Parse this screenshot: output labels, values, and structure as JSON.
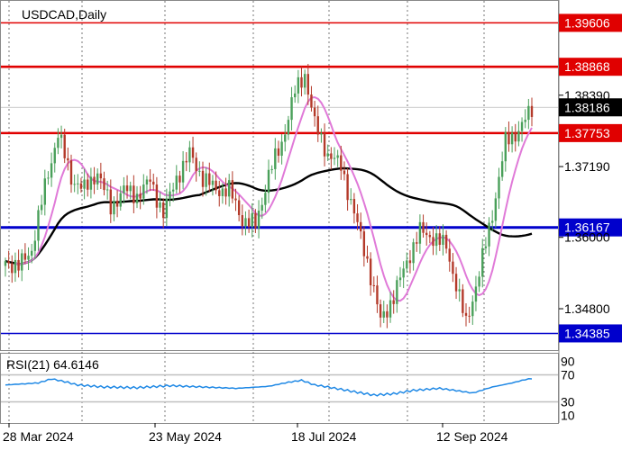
{
  "chart_data": [
    {
      "type": "candlestick",
      "title": "USDCAD,Daily",
      "x_tick_labels": [
        "28 Mar 2024",
        "23 May 2024",
        "18 Jul 2024",
        "12 Sep 2024"
      ],
      "y_tick_labels": [
        "1.38390",
        "1.37190",
        "1.36000",
        "1.34800"
      ],
      "ylim": [
        1.3418,
        1.399
      ],
      "current_price": "1.38186",
      "grid": "vertical dashed",
      "colors": {
        "bull": "#4aa05a",
        "bear": "#b43a2a",
        "ma_fast": "#e07ad8",
        "ma_slow": "#000000",
        "resistance": "#e00000",
        "support": "#0000cc"
      },
      "levels": [
        {
          "label": "1.39606",
          "value": 1.39606,
          "kind": "resistance"
        },
        {
          "label": "1.38868",
          "value": 1.38868,
          "kind": "resistance"
        },
        {
          "label": "1.37753",
          "value": 1.37753,
          "kind": "resistance"
        },
        {
          "label": "1.36167",
          "value": 1.36167,
          "kind": "support"
        },
        {
          "label": "1.34385",
          "value": 1.34385,
          "kind": "support"
        }
      ],
      "close_anchors": [
        [
          0,
          1.356
        ],
        [
          4,
          1.355
        ],
        [
          8,
          1.358
        ],
        [
          12,
          1.3685
        ],
        [
          16,
          1.3775
        ],
        [
          20,
          1.37
        ],
        [
          24,
          1.368
        ],
        [
          28,
          1.371
        ],
        [
          32,
          1.365
        ],
        [
          36,
          1.368
        ],
        [
          40,
          1.367
        ],
        [
          44,
          1.3695
        ],
        [
          48,
          1.364
        ],
        [
          52,
          1.37
        ],
        [
          56,
          1.374
        ],
        [
          60,
          1.37
        ],
        [
          64,
          1.368
        ],
        [
          68,
          1.368
        ],
        [
          72,
          1.363
        ],
        [
          76,
          1.362
        ],
        [
          80,
          1.3705
        ],
        [
          84,
          1.376
        ],
        [
          88,
          1.3845
        ],
        [
          91,
          1.3875
        ],
        [
          94,
          1.379
        ],
        [
          98,
          1.374
        ],
        [
          102,
          1.372
        ],
        [
          106,
          1.364
        ],
        [
          110,
          1.356
        ],
        [
          114,
          1.346
        ],
        [
          118,
          1.35
        ],
        [
          122,
          1.356
        ],
        [
          126,
          1.361
        ],
        [
          130,
          1.36
        ],
        [
          134,
          1.3585
        ],
        [
          137,
          1.352
        ],
        [
          140,
          1.3455
        ],
        [
          144,
          1.354
        ],
        [
          148,
          1.364
        ],
        [
          152,
          1.376
        ],
        [
          156,
          1.378
        ],
        [
          160,
          1.3815
        ]
      ]
    },
    {
      "type": "line",
      "title": "RSI(21) 64.6146",
      "y_tick_labels": [
        "90",
        "70",
        "30",
        "10"
      ],
      "ylim": [
        0,
        100
      ],
      "levels": [
        70,
        30
      ],
      "rsi_anchors": [
        [
          0,
          55
        ],
        [
          10,
          58
        ],
        [
          14,
          64
        ],
        [
          18,
          60
        ],
        [
          22,
          55
        ],
        [
          30,
          52
        ],
        [
          40,
          51
        ],
        [
          50,
          54
        ],
        [
          60,
          52
        ],
        [
          70,
          50
        ],
        [
          80,
          53
        ],
        [
          86,
          59
        ],
        [
          90,
          62
        ],
        [
          94,
          55
        ],
        [
          98,
          52
        ],
        [
          106,
          45
        ],
        [
          112,
          40
        ],
        [
          118,
          42
        ],
        [
          124,
          47
        ],
        [
          132,
          50
        ],
        [
          138,
          46
        ],
        [
          142,
          43
        ],
        [
          148,
          52
        ],
        [
          154,
          58
        ],
        [
          158,
          63
        ],
        [
          160,
          64.6
        ]
      ]
    }
  ]
}
